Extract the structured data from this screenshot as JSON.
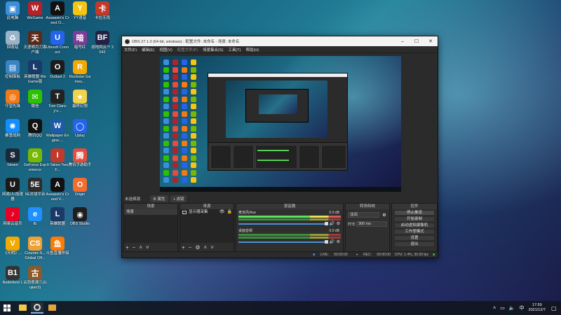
{
  "desktop": {
    "icons": [
      {
        "label": "此电脑",
        "color": "#3a8fd8",
        "glyph": "▣"
      },
      {
        "label": "WeGame",
        "color": "#b3212b",
        "glyph": "W"
      },
      {
        "label": "Assassin's Creed O...",
        "color": "#111111",
        "glyph": "A"
      },
      {
        "label": "YY语音",
        "color": "#f6c513",
        "glyph": "Y"
      },
      {
        "label": "卡拉无雨",
        "color": "#c0392b",
        "glyph": "卡"
      },
      {
        "label": "回收站",
        "color": "#9ab3c8",
        "glyph": "♻"
      },
      {
        "label": "天涯明月刀客户端",
        "color": "#5a2a1a",
        "glyph": "天"
      },
      {
        "label": "Ubisoft Connect",
        "color": "#2563eb",
        "glyph": "U"
      },
      {
        "label": "暗号红",
        "color": "#7d3c98",
        "glyph": "暗"
      },
      {
        "label": "战地风云™ 2042",
        "color": "#222244",
        "glyph": "BF"
      },
      {
        "label": "控制面板",
        "color": "#3b83c4",
        "glyph": "▤"
      },
      {
        "label": "英雄联盟 WeGame版",
        "color": "#1a3a6a",
        "glyph": "L"
      },
      {
        "label": "Outlast 2",
        "color": "#1b1b1b",
        "glyph": "O"
      },
      {
        "label": "Rockstar Games...",
        "color": "#f2a900",
        "glyph": "R"
      },
      {
        "label": "守望先锋",
        "color": "#f07a18",
        "glyph": "◎"
      },
      {
        "label": "微信",
        "color": "#2dc100",
        "glyph": "✉"
      },
      {
        "label": "Tom Clancy's...",
        "color": "#222222",
        "glyph": "T"
      },
      {
        "label": "最终幻想",
        "color": "#f2d34c",
        "glyph": "★"
      },
      {
        "label": "暴雪战网",
        "color": "#148eff",
        "glyph": "✺"
      },
      {
        "label": "腾讯QQ",
        "color": "#111111",
        "glyph": "Q"
      },
      {
        "label": "Wallpaper Engine:...",
        "color": "#1d5aa8",
        "glyph": "W"
      },
      {
        "label": "Uplay",
        "color": "#2563eb",
        "glyph": "◯"
      },
      {
        "label": "Steam",
        "color": "#1b2838",
        "glyph": "S"
      },
      {
        "label": "GeForce Experience",
        "color": "#76b900",
        "glyph": "G"
      },
      {
        "label": "It Takes Two F...",
        "color": "#c0392b",
        "glyph": "I"
      },
      {
        "label": "腾讯手游助手",
        "color": "#e74c3c",
        "glyph": "腾"
      },
      {
        "label": "网易UU加速器",
        "color": "#1a1a1a",
        "glyph": "U"
      },
      {
        "label": "5E对战平台",
        "color": "#2c2c2c",
        "glyph": "5E"
      },
      {
        "label": "Assassin's Creed V...",
        "color": "#111111",
        "glyph": "A"
      },
      {
        "label": "Origin",
        "color": "#f56c2d",
        "glyph": "O"
      },
      {
        "label": "网易云音乐",
        "color": "#e60026",
        "glyph": "♪"
      },
      {
        "label": "IE",
        "color": "#1e90ff",
        "glyph": "e"
      },
      {
        "label": "英雄联盟",
        "color": "#1a3a6a",
        "glyph": "L"
      },
      {
        "label": "OBS Studio",
        "color": "#1e1e1e",
        "glyph": "◉"
      },
      {
        "label": "《光明》...",
        "color": "#f2a900",
        "glyph": "V"
      },
      {
        "label": "Counter-S... Global Off...",
        "color": "#f0a030",
        "glyph": "CS"
      },
      {
        "label": "斗鱼直播伴侣",
        "color": "#ff7a00",
        "glyph": "鱼"
      },
      {
        "label": "Battlefield 1",
        "color": "#333333",
        "glyph": "B1"
      },
      {
        "label": "古剑奇谭三(Gujian3)",
        "color": "#8b5a2b",
        "glyph": "古"
      }
    ]
  },
  "obs": {
    "title": "OBS 27.1.3 (64-bit, windows) - 配置文件: 未命名 - 场景: 未命名",
    "menu": [
      "文件(F)",
      "编辑(E)",
      "视图(V)",
      "配置文件(P)",
      "场景集合(S)",
      "工具(T)",
      "帮助(H)"
    ],
    "panel_header": "未选择源",
    "properties_btn": "属性",
    "filters_btn": "滤镜",
    "scenes": {
      "title": "场景",
      "items": [
        "场景"
      ]
    },
    "sources": {
      "title": "来源",
      "items": [
        "显示器采集"
      ]
    },
    "mixer": {
      "title": "混音器",
      "channels": [
        {
          "name": "麦克风/Aux",
          "db": "0.0 dB"
        },
        {
          "name": "桌面音频",
          "db": "0.0 dB"
        }
      ]
    },
    "transitions": {
      "title": "转场特效",
      "selected": "淡出",
      "duration_label": "时长",
      "duration": "300 ms"
    },
    "controls": {
      "title": "控件",
      "buttons": [
        "停止推流",
        "开始录制",
        "启动虚拟摄像机",
        "工作室模式",
        "设置",
        "退出"
      ]
    },
    "status": {
      "live": "LIVE:",
      "live_time": "00:00:00",
      "rec": "REC:",
      "rec_time": "00:00:00",
      "cpu": "CPU: 1.4%, 30.00 fps"
    }
  },
  "taskbar": {
    "time": "17:59",
    "date": "2021/12/7",
    "lang": "中"
  }
}
